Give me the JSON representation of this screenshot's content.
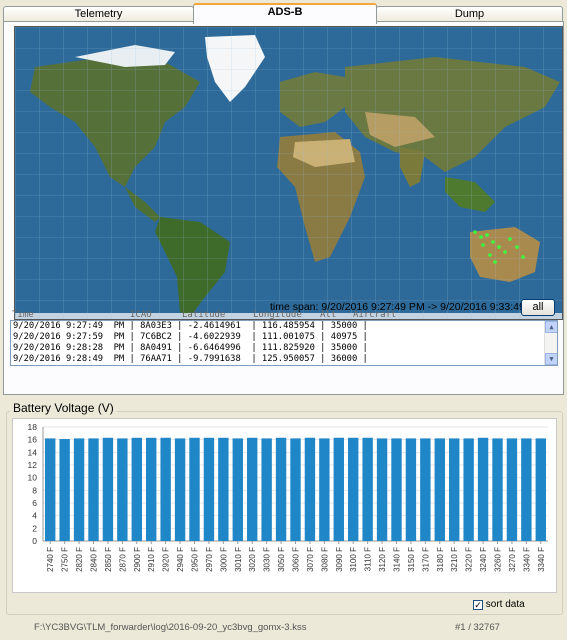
{
  "tabs": [
    {
      "label": "Telemetry"
    },
    {
      "label": "ADS-B"
    },
    {
      "label": "Dump"
    }
  ],
  "map": {
    "time_span": "time span: 9/20/2016 9:27:49 PM -> 9/20/2016 9:33:49 PM",
    "all_button": "all"
  },
  "log": {
    "headers": [
      "Time",
      "ICAO",
      "Latitude",
      "Longitude",
      "Alt",
      "Aircraft"
    ],
    "rows": [
      "9/20/2016 9:27:49  PM | 8A03E3 | -2.4614961  | 116.485954 | 35000 |",
      "9/20/2016 9:27:59  PM | 7C6BC2 | -4.6022939  | 111.001075 | 40975 |",
      "9/20/2016 9:28:28  PM | 8A0491 | -6.6464996  | 111.825920 | 35000 |",
      "9/20/2016 9:28:49  PM | 76AA71 | -9.7991638  | 125.950057 | 36000 |"
    ]
  },
  "battery": {
    "title": "Battery Voltage (V)",
    "sort_label": "sort data",
    "sort_checked": "✓"
  },
  "chart_data": {
    "type": "bar",
    "ylim": [
      0,
      18
    ],
    "yticks": [
      0,
      2,
      4,
      6,
      8,
      10,
      12,
      14,
      16,
      18
    ],
    "categories": [
      "2740 F",
      "2750 F",
      "2820 F",
      "2840 F",
      "2850 F",
      "2870 F",
      "2900 F",
      "2910 F",
      "2920 F",
      "2940 F",
      "2950 F",
      "2970 F",
      "3000 F",
      "3010 F",
      "3020 F",
      "3030 F",
      "3050 F",
      "3060 F",
      "3070 F",
      "3080 F",
      "3090 F",
      "3100 F",
      "3110 F",
      "3120 F",
      "3140 F",
      "3150 F",
      "3170 F",
      "3180 F",
      "3210 F",
      "3220 F",
      "3240 F",
      "3260 F",
      "3270 F",
      "3340 F",
      "3340 F"
    ],
    "values": [
      16.2,
      16.1,
      16.2,
      16.2,
      16.3,
      16.2,
      16.3,
      16.3,
      16.3,
      16.2,
      16.3,
      16.3,
      16.3,
      16.2,
      16.3,
      16.2,
      16.3,
      16.2,
      16.3,
      16.2,
      16.3,
      16.3,
      16.3,
      16.2,
      16.2,
      16.2,
      16.2,
      16.2,
      16.2,
      16.2,
      16.3,
      16.2,
      16.2,
      16.2,
      16.2
    ],
    "bar_color": "#1f86c8"
  },
  "status": {
    "path": "F:\\YC3BVG\\TLM_forwarder\\log\\2016-09-20_yc3bvg_gomx-3.kss",
    "count": "#1 / 32767"
  }
}
